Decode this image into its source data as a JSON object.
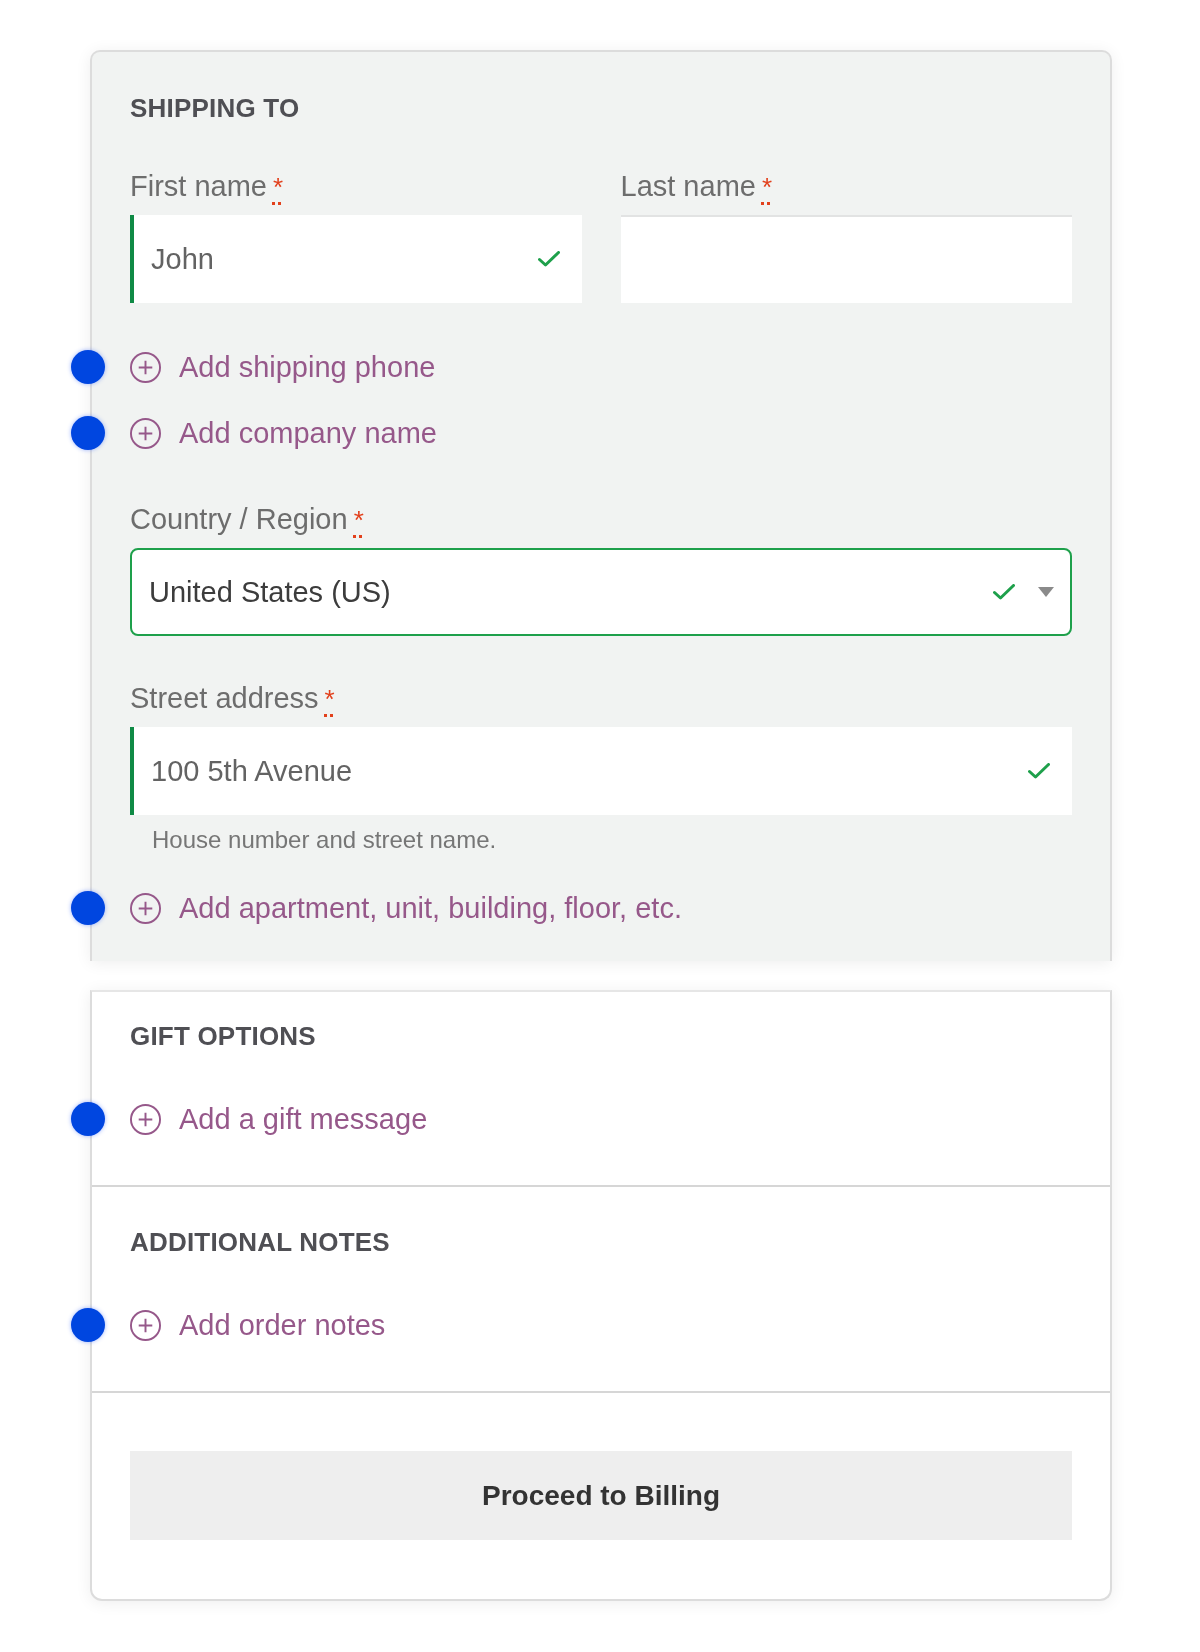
{
  "shipping": {
    "title": "SHIPPING TO",
    "rows": [
      {
        "kind": "fields",
        "fields": [
          {
            "kind": "text",
            "label": "First name",
            "required_mark": "*",
            "value": "John",
            "valid": true
          },
          {
            "kind": "text",
            "label": "Last name",
            "required_mark": "*",
            "valid": false
          }
        ]
      },
      {
        "kind": "link",
        "text": "Add shipping phone",
        "marked": true
      },
      {
        "kind": "link",
        "text": "Add company name",
        "marked": true
      },
      {
        "kind": "fields",
        "fields": [
          {
            "kind": "select",
            "label": "Country / Region",
            "required_mark": "*",
            "value": "United States (US)",
            "valid": true
          }
        ]
      },
      {
        "kind": "fields",
        "fields": [
          {
            "kind": "text",
            "label": "Street address",
            "required_mark": "*",
            "value": "100 5th Avenue",
            "valid": true,
            "hint": "House number and street name."
          }
        ]
      },
      {
        "kind": "link",
        "text": "Add apartment, unit, building, floor, etc.",
        "marked": true
      }
    ]
  },
  "extra_sections": [
    {
      "title": "GIFT OPTIONS",
      "links": [
        {
          "text": "Add a gift message",
          "marked": true
        }
      ]
    },
    {
      "title": "ADDITIONAL NOTES",
      "links": [
        {
          "text": "Add order notes",
          "marked": true
        }
      ]
    }
  ],
  "proceed_button": {
    "label": "Proceed to Billing"
  }
}
